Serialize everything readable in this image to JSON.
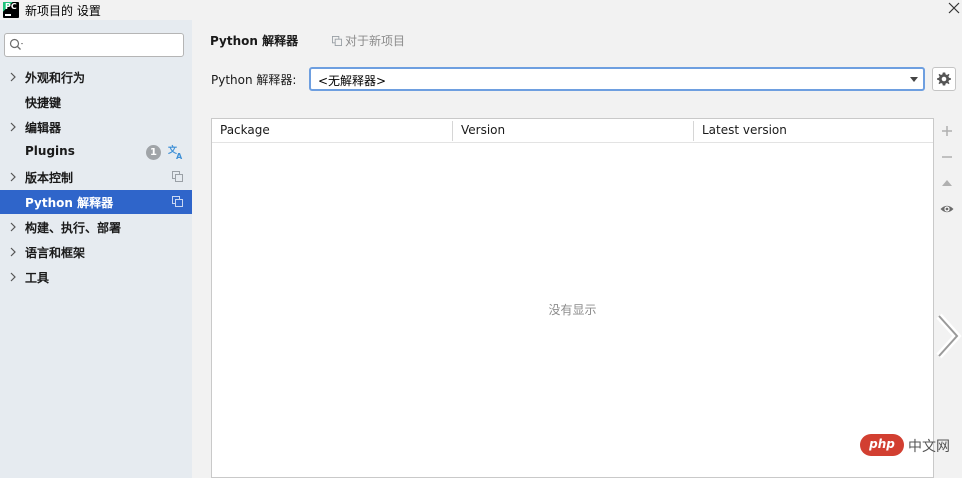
{
  "window": {
    "title": "新项目的 设置",
    "app_icon_text": "PC"
  },
  "sidebar": {
    "search_placeholder": "",
    "items": [
      {
        "label": "外观和行为",
        "expandable": true
      },
      {
        "label": "快捷键",
        "expandable": false
      },
      {
        "label": "编辑器",
        "expandable": true
      },
      {
        "label": "Plugins",
        "expandable": false,
        "badge": "1"
      },
      {
        "label": "版本控制",
        "expandable": true
      },
      {
        "label": "Python 解释器",
        "expandable": false,
        "selected": true
      },
      {
        "label": "构建、执行、部署",
        "expandable": true
      },
      {
        "label": "语言和框架",
        "expandable": true
      },
      {
        "label": "工具",
        "expandable": true
      }
    ]
  },
  "main": {
    "breadcrumb": "Python 解释器",
    "about_link": "对于新项目",
    "interpreter_label": "Python 解释器:",
    "interpreter_value": "<无解释器>",
    "table": {
      "columns": [
        "Package",
        "Version",
        "Latest version"
      ],
      "empty_text": "没有显示"
    }
  },
  "watermark": {
    "logo": "php",
    "text": "中文网"
  },
  "colors": {
    "sidebar_bg": "#e6ebf0",
    "selection": "#2f65ca",
    "focus_border": "#6e9fe0"
  }
}
